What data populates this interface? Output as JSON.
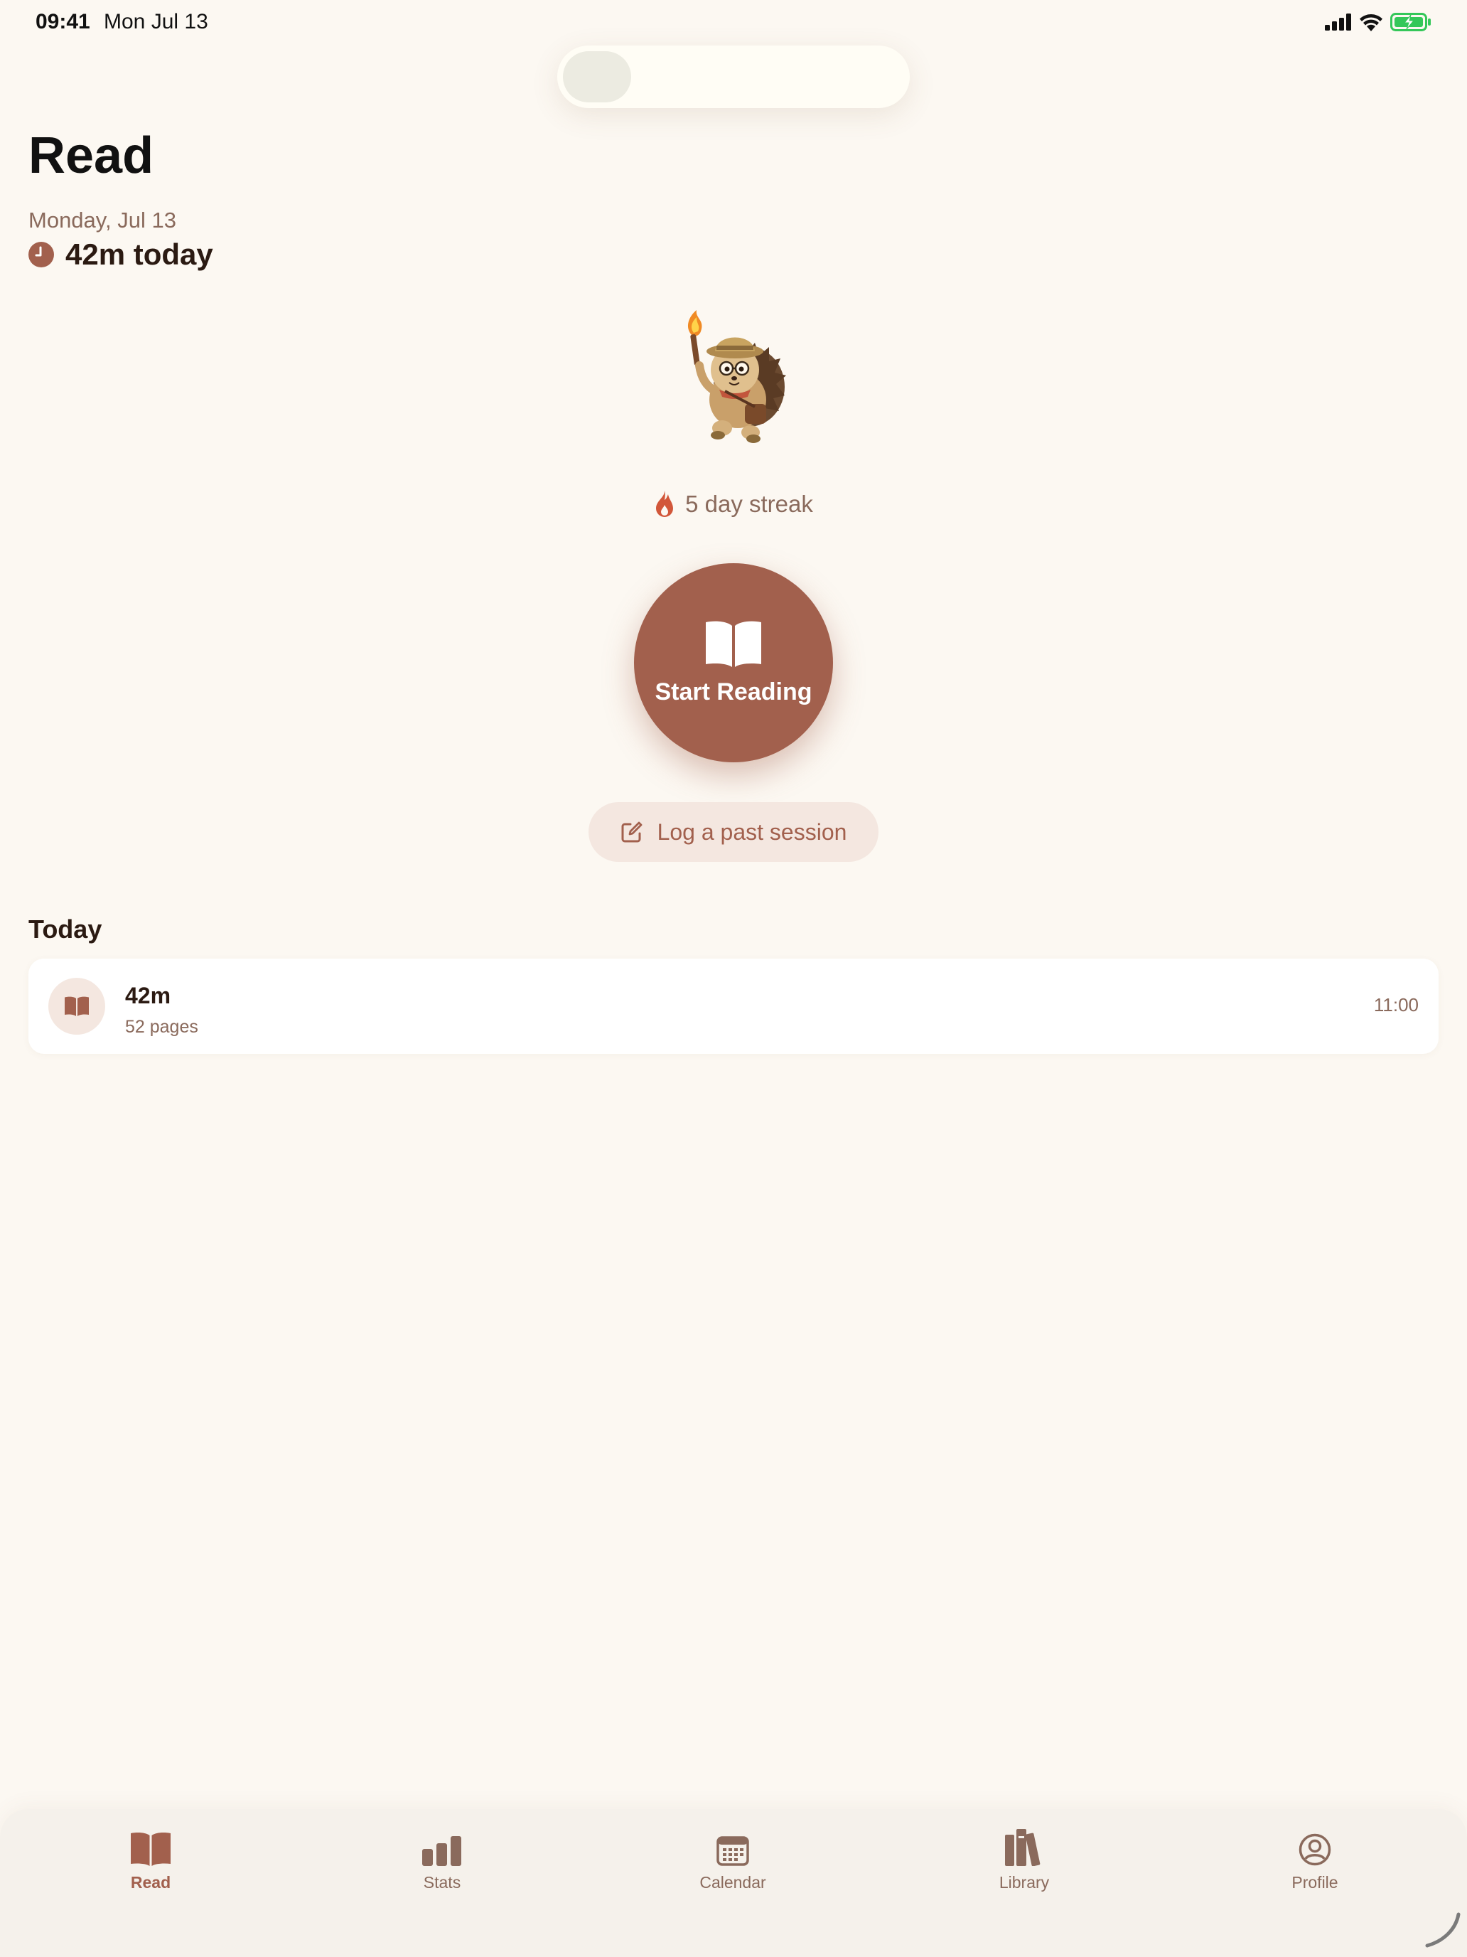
{
  "status_bar": {
    "time": "09:41",
    "date": "Mon Jul 13"
  },
  "header": {
    "title": "Read",
    "date": "Monday, Jul 13",
    "today_total": "42m today"
  },
  "streak": {
    "label": "5 day streak"
  },
  "actions": {
    "start_reading": "Start Reading",
    "log_past_session": "Log a past session"
  },
  "today": {
    "section_title": "Today",
    "sessions": [
      {
        "duration": "42m",
        "pages": "52 pages",
        "time": "11:00"
      }
    ]
  },
  "tab_bar": {
    "tabs": [
      {
        "label": "Read",
        "icon": "book-open-icon",
        "active": true
      },
      {
        "label": "Stats",
        "icon": "bar-chart-icon",
        "active": false
      },
      {
        "label": "Calendar",
        "icon": "calendar-icon",
        "active": false
      },
      {
        "label": "Library",
        "icon": "books-icon",
        "active": false
      },
      {
        "label": "Profile",
        "icon": "person-circle-icon",
        "active": false
      }
    ]
  },
  "colors": {
    "accent": "#a2604d",
    "background": "#fcf8f2",
    "muted_text": "#8a6a5c",
    "streak_flame": "#d2573a"
  }
}
